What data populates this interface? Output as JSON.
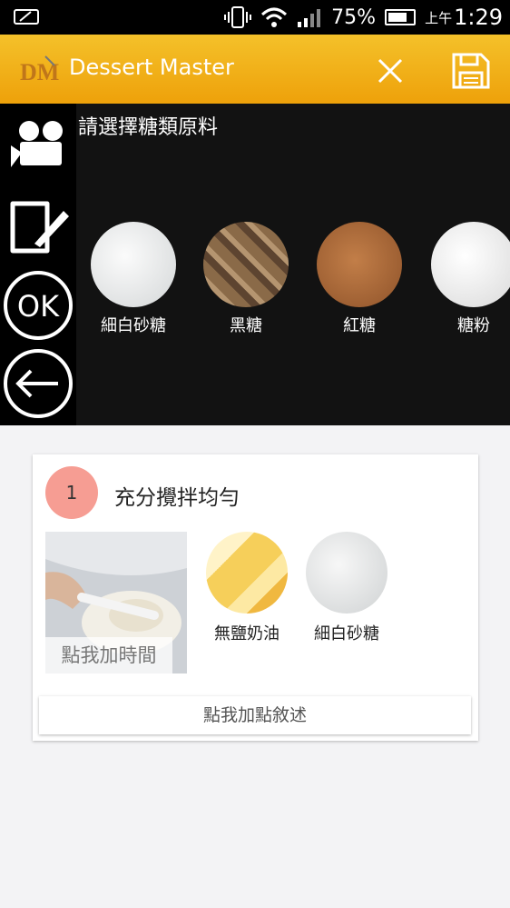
{
  "status_bar": {
    "battery": "75%",
    "ampm": "上午",
    "time": "1:29"
  },
  "appbar": {
    "logo_text": "DM",
    "title": "Dessert Master"
  },
  "panel": {
    "heading": "請選擇糖類原料",
    "sugars": [
      {
        "label": "細白砂糖",
        "color": "#e8eaeb"
      },
      {
        "label": "黑糖",
        "color": "#6e5236"
      },
      {
        "label": "紅糖",
        "color": "#a86a3a"
      },
      {
        "label": "糖粉",
        "color": "#efefef"
      }
    ],
    "ok_label": "OK"
  },
  "step": {
    "number": "1",
    "title": "充分攪拌均勻",
    "time_label": "點我加時間",
    "ingredients": [
      {
        "label": "無鹽奶油",
        "color": "#f5d36b"
      },
      {
        "label": "細白砂糖",
        "color": "#e8eaeb"
      }
    ],
    "desc_label": "點我加點敘述"
  },
  "colors": {
    "accent": "#eea10a",
    "step_badge": "#f69d93"
  }
}
